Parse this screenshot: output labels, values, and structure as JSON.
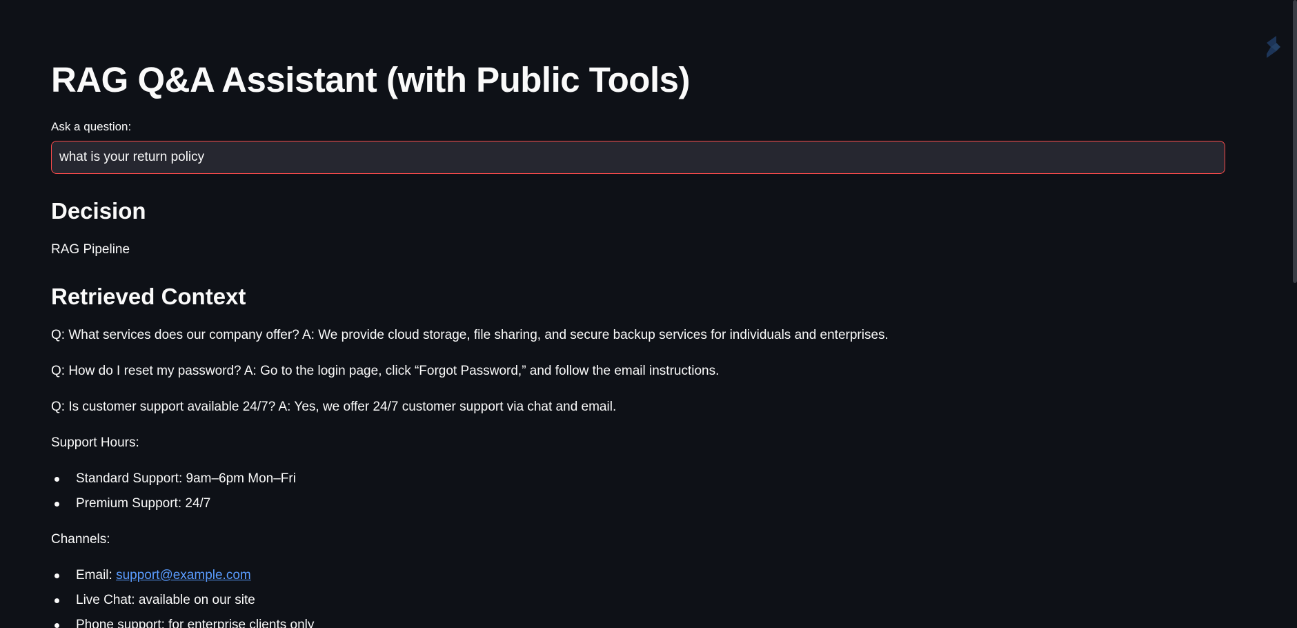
{
  "page": {
    "title": "RAG Q&A Assistant (with Public Tools)"
  },
  "question": {
    "label": "Ask a question:",
    "value": "what is your return policy"
  },
  "decision": {
    "heading": "Decision",
    "value": "RAG Pipeline"
  },
  "context": {
    "heading": "Retrieved Context",
    "qa": [
      "Q: What services does our company offer? A: We provide cloud storage, file sharing, and secure backup services for individuals and enterprises.",
      "Q: How do I reset my password? A: Go to the login page, click “Forgot Password,” and follow the email instructions.",
      "Q: Is customer support available 24/7? A: Yes, we offer 24/7 customer support via chat and email."
    ],
    "support_hours": {
      "label": "Support Hours:",
      "items": [
        "Standard Support: 9am–6pm Mon–Fri",
        "Premium Support: 24/7"
      ]
    },
    "channels": {
      "label": "Channels:",
      "email_prefix": "Email: ",
      "email_link": "support@example.com",
      "items": [
        "Live Chat: available on our site",
        "Phone support: for enterprise clients only"
      ]
    }
  },
  "icons": {
    "logo": "streamlit-logo-icon"
  },
  "colors": {
    "background": "#0e1117",
    "input_background": "#262730",
    "input_border": "#ff4b4b",
    "link": "#5a9cff",
    "text": "#fafafa"
  }
}
